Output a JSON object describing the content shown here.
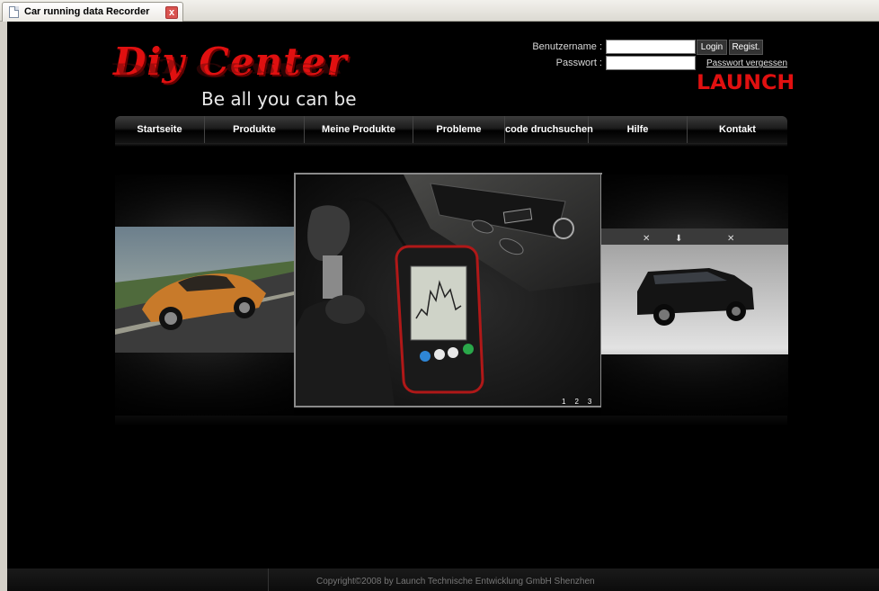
{
  "browser": {
    "tab_title": "Car running data Recorder",
    "close_label": "x"
  },
  "logo": {
    "main_text": "Diy Center",
    "tagline": "Be all you can be"
  },
  "login": {
    "username_label": "Benutzername :",
    "password_label": "Passwort :",
    "username_value": "",
    "password_value": "",
    "login_button": "Login",
    "register_button": "Regist.",
    "forgot_link": "Passwort vergessen"
  },
  "brand": {
    "launch_logo": "LAUNCH"
  },
  "nav": {
    "items": [
      {
        "label": "Startseite"
      },
      {
        "label": "Produkte"
      },
      {
        "label": "Meine Produkte"
      },
      {
        "label": "Probleme"
      },
      {
        "label": "code druchsuchen"
      },
      {
        "label": "Hilfe"
      },
      {
        "label": "Kontakt"
      }
    ]
  },
  "carousel": {
    "pages": [
      "1",
      "2",
      "3"
    ]
  },
  "footer": {
    "copyright": "Copyright©2008 by Launch Technische Entwicklung GmbH Shenzhen"
  },
  "colors": {
    "brand_red": "#e01010",
    "page_bg": "#000000",
    "nav_bg": "#1c1c1c"
  }
}
